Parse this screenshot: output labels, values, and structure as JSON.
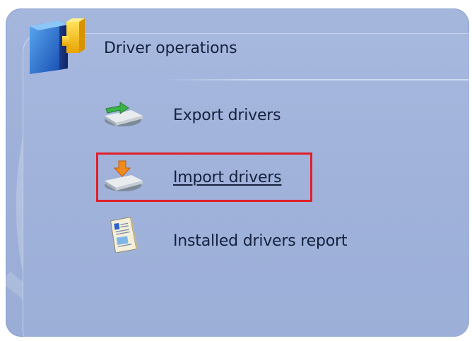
{
  "panel": {
    "title": "Driver operations",
    "logo_icon": "driver-operations-icon"
  },
  "items": [
    {
      "label": "Export drivers",
      "icon": "export-drivers-icon"
    },
    {
      "label": "Import drivers",
      "icon": "import-drivers-icon",
      "highlighted": true
    },
    {
      "label": "Installed drivers report",
      "icon": "report-icon"
    }
  ],
  "colors": {
    "panel_background": "#a0b2da",
    "text": "#15213d",
    "highlight_border": "#e0202a"
  }
}
